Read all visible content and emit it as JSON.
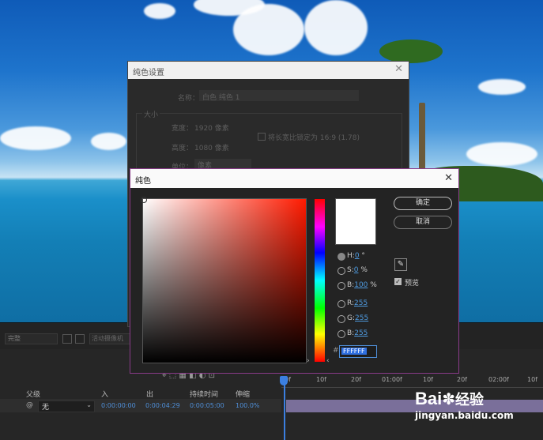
{
  "settings_dialog": {
    "title": "纯色设置",
    "name_label": "名称：",
    "name_value": "白色 纯色 1",
    "size_group": "大小",
    "width_label": "宽度：",
    "width_value": "1920 像素",
    "height_label": "高度：",
    "height_value": "1080 像素",
    "lock_ratio_label": "将长宽比锁定为 16:9 (1.78)",
    "units_label": "单位：",
    "units_value": "像素"
  },
  "color_dialog": {
    "title": "纯色",
    "ok_label": "确定",
    "cancel_label": "取消",
    "preview_label": "预览",
    "h_label": "H:",
    "h_value": "0",
    "h_unit": "°",
    "s_label": "S:",
    "s_value": "0",
    "s_unit": "%",
    "b_label": "B:",
    "b_value": "100",
    "b_unit": "%",
    "r_label": "R:",
    "r_value": "255",
    "g_label": "G:",
    "g_value": "255",
    "bl_label": "B:",
    "bl_value": "255",
    "hex_prefix": "#",
    "hex_value": "FFFFFF",
    "current_color": "#FFFFFF"
  },
  "panel": {
    "resolution": "完整",
    "camera": "活动摄像机"
  },
  "timeline": {
    "ruler": [
      "0f",
      "10f",
      "20f",
      "01:00f",
      "10f",
      "20f",
      "02:00f",
      "10f"
    ],
    "columns": {
      "parent": "父级",
      "in": "入",
      "out": "出",
      "duration": "持续时间",
      "stretch": "伸缩"
    },
    "row": {
      "parent_value": "无",
      "in": "0:00:00:00",
      "out": "0:00:04:29",
      "duration": "0:00:05:00",
      "stretch": "100.0%"
    }
  },
  "watermark": {
    "brand": "Bai",
    "brand2": "经验",
    "url": "jingyan.baidu.com"
  }
}
